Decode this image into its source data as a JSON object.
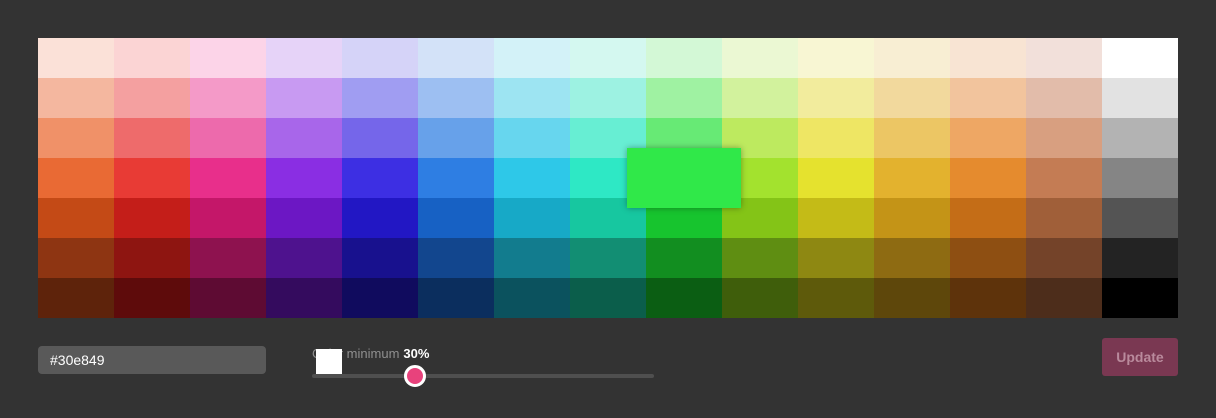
{
  "palette": {
    "columns": 15,
    "rows": [
      [
        "#fbe1d8",
        "#fbd4d4",
        "#fcd4e8",
        "#e6d3f8",
        "#d5d3f8",
        "#d3e2f8",
        "#d3f2f8",
        "#d4f8f0",
        "#d3f8d6",
        "#ebf8d3",
        "#f8f6d3",
        "#f8eed3",
        "#f8e4d3",
        "#f2e0da",
        "#ffffff"
      ],
      [
        "#f4b79f",
        "#f4a0a0",
        "#f49ac8",
        "#c89af2",
        "#a09df2",
        "#9dbff2",
        "#9de4f2",
        "#9df2e2",
        "#9ff2a2",
        "#d2f29d",
        "#f2ec9d",
        "#f2d99d",
        "#f2c49d",
        "#e2bcaa",
        "#e2e2e2"
      ],
      [
        "#f09168",
        "#ee6b6b",
        "#ed6aac",
        "#a866ea",
        "#7566ea",
        "#67a1ea",
        "#67d6ee",
        "#67eed3",
        "#67ea75",
        "#bdea5f",
        "#eee664",
        "#ecc664",
        "#eea764",
        "#d89f80",
        "#b3b3b3"
      ],
      [
        "#e96a34",
        "#e83b35",
        "#e82f8b",
        "#8a2ee3",
        "#3d2fe3",
        "#2e7ee3",
        "#2ec8e8",
        "#2ee8c5",
        "#2ee85a",
        "#a3e22e",
        "#e5e22e",
        "#e3b22e",
        "#e58b2e",
        "#c47c54",
        "#858585"
      ],
      [
        "#c44a16",
        "#c41e19",
        "#c41769",
        "#6c17c4",
        "#2217c4",
        "#1761c4",
        "#17a9c7",
        "#17c7a0",
        "#17c42e",
        "#84c417",
        "#c4bb17",
        "#c49417",
        "#c46d17",
        "#a05f39",
        "#545454"
      ],
      [
        "#8e3512",
        "#8e1511",
        "#8e124f",
        "#4e128e",
        "#18118e",
        "#12468e",
        "#127c8e",
        "#128e73",
        "#128e20",
        "#5f8e12",
        "#8e8812",
        "#8e6b12",
        "#8e4f12",
        "#744329",
        "#232323"
      ],
      [
        "#5e230b",
        "#5e0b0b",
        "#5e0b33",
        "#340b5e",
        "#100b5e",
        "#0b2e5e",
        "#0b525e",
        "#0b5e4b",
        "#0b5e13",
        "#3f5e0b",
        "#5e5a0b",
        "#5e470b",
        "#5e330b",
        "#4d2d1b",
        "#000000"
      ]
    ],
    "selected_color": "#30e849"
  },
  "hex_input": {
    "value": "#30e849"
  },
  "contrast": {
    "label": "Color minimum",
    "value_label": "30%",
    "fraction": 0.3
  },
  "update_button": {
    "label": "Update"
  }
}
